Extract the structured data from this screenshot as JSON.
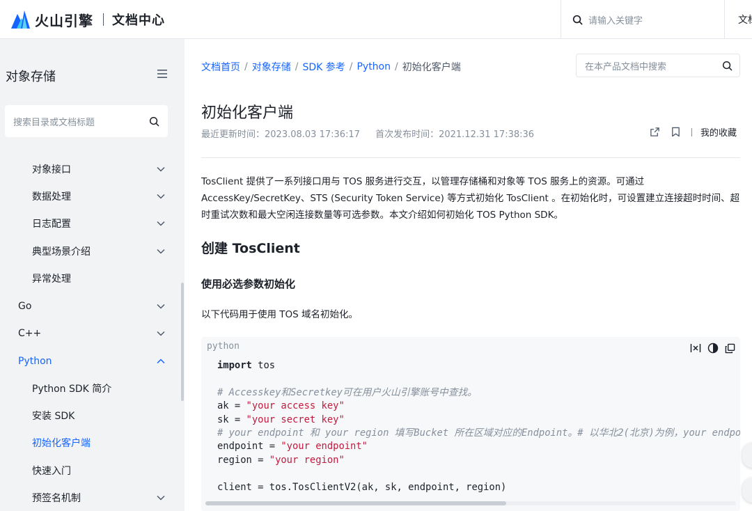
{
  "header": {
    "brand": "火山引擎",
    "section": "文档中心",
    "search_placeholder": "请输入关键字",
    "right_tab": "文档"
  },
  "sidebar": {
    "title": "对象存储",
    "search_placeholder": "搜索目录或文档标题",
    "items": [
      {
        "label": "对象接口",
        "level": 2,
        "expandable": true
      },
      {
        "label": "数据处理",
        "level": 2,
        "expandable": true
      },
      {
        "label": "日志配置",
        "level": 2,
        "expandable": true
      },
      {
        "label": "典型场景介绍",
        "level": 2,
        "expandable": true
      },
      {
        "label": "异常处理",
        "level": 2,
        "expandable": false
      },
      {
        "label": "Go",
        "level": 1,
        "expandable": true
      },
      {
        "label": "C++",
        "level": 1,
        "expandable": true
      },
      {
        "label": "Python",
        "level": 1,
        "expandable": true,
        "expanded": true
      },
      {
        "label": "Python SDK 简介",
        "level": 2,
        "expandable": false
      },
      {
        "label": "安装 SDK",
        "level": 2,
        "expandable": false
      },
      {
        "label": "初始化客户端",
        "level": 2,
        "expandable": false,
        "active": true
      },
      {
        "label": "快速入门",
        "level": 2,
        "expandable": false
      },
      {
        "label": "预签名机制",
        "level": 2,
        "expandable": true
      }
    ]
  },
  "breadcrumb": {
    "links": [
      "文档首页",
      "对象存储",
      "SDK 参考",
      "Python"
    ],
    "current": "初始化客户端"
  },
  "page_search_placeholder": "在本产品文档中搜索",
  "article": {
    "title": "初始化客户端",
    "updated": "最近更新时间：2023.08.03 17:36:17",
    "published": "首次发布时间：2021.12.31 17:38:36",
    "favorites_label": "我的收藏",
    "intro": "TosClient 提供了一系列接口用与 TOS 服务进行交互，以管理存储桶和对象等 TOS 服务上的资源。可通过 AccessKey/SecretKey、STS (Security Token Service) 等方式初始化 TosClient 。在初始化时，可设置建立连接超时时间、超时重试次数和最大空闲连接数量等可选参数。本文介绍如何初始化 TOS Python SDK。",
    "h2": "创建 TosClient",
    "h3": "使用必选参数初始化",
    "para": "以下代码用于使用 TOS 域名初始化。"
  },
  "code": {
    "language": "python",
    "lines": {
      "l1_kw": "import",
      "l1_rest": " tos",
      "l3_comment": "# Accesskey和Secretkey可在用户火山引擎账号中查找。",
      "l4_pre": "ak = ",
      "l4_str": "\"your access key\"",
      "l5_pre": "sk = ",
      "l5_str": "\"your secret key\"",
      "l6_comment": "# your endpoint 和 your region 填写Bucket 所在区域对应的Endpoint。# 以华北2(北京)为例，your endpoint 填写 tos-cn-beijing.volces.com",
      "l7_pre": "endpoint = ",
      "l7_str": "\"your endpoint\"",
      "l8_pre": "region = ",
      "l8_str": "\"your region\"",
      "l10": "client = tos.TosClientV2(ak, sk, endpoint, region)"
    }
  },
  "colors": {
    "accent": "#1664ff",
    "sidebar_bg": "#f2f3f5",
    "code_string": "#c41a3d",
    "code_comment": "#86909c"
  },
  "icons": [
    "search-icon",
    "menu-icon",
    "chevron-down-icon",
    "chevron-up-icon",
    "share-icon",
    "bookmark-icon",
    "wrap-icon",
    "theme-icon",
    "copy-icon"
  ]
}
